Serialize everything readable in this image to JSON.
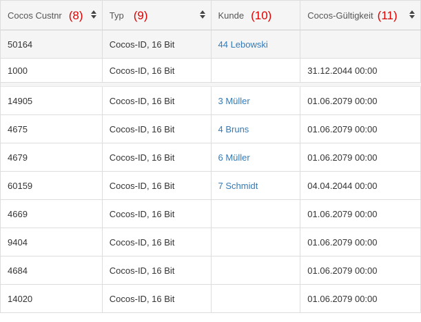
{
  "table": {
    "headers": [
      {
        "label": "Cocos Custnr",
        "annotation": "(8)"
      },
      {
        "label": "Typ",
        "annotation": "(9)"
      },
      {
        "label": "Kunde",
        "annotation": "(10)"
      },
      {
        "label": "Cocos-Gültigkeit",
        "annotation": "(11)"
      }
    ],
    "rows": [
      {
        "custnr": "50164",
        "typ": "Cocos-ID, 16 Bit",
        "kunde": "44 Lebowski",
        "gueltigkeit": ""
      },
      {
        "custnr": "1000",
        "typ": "Cocos-ID, 16 Bit",
        "kunde": "",
        "gueltigkeit": "31.12.2044 00:00"
      },
      {
        "custnr": "14905",
        "typ": "Cocos-ID, 16 Bit",
        "kunde": "3 Müller",
        "gueltigkeit": "01.06.2079 00:00"
      },
      {
        "custnr": "4675",
        "typ": "Cocos-ID, 16 Bit",
        "kunde": "4 Bruns",
        "gueltigkeit": "01.06.2079 00:00"
      },
      {
        "custnr": "4679",
        "typ": "Cocos-ID, 16 Bit",
        "kunde": "6 Müller",
        "gueltigkeit": "01.06.2079 00:00"
      },
      {
        "custnr": "60159",
        "typ": "Cocos-ID, 16 Bit",
        "kunde": "7 Schmidt",
        "gueltigkeit": "04.04.2044 00:00"
      },
      {
        "custnr": "4669",
        "typ": "Cocos-ID, 16 Bit",
        "kunde": "",
        "gueltigkeit": "01.06.2079 00:00"
      },
      {
        "custnr": "9404",
        "typ": "Cocos-ID, 16 Bit",
        "kunde": "",
        "gueltigkeit": "01.06.2079 00:00"
      },
      {
        "custnr": "4684",
        "typ": "Cocos-ID, 16 Bit",
        "kunde": "",
        "gueltigkeit": "01.06.2079 00:00"
      },
      {
        "custnr": "14020",
        "typ": "Cocos-ID, 16 Bit",
        "kunde": "",
        "gueltigkeit": "01.06.2079 00:00"
      }
    ]
  },
  "colors": {
    "link": "#337ab7",
    "annotation": "#e00000",
    "header_bg": "#f5f5f5",
    "border": "#dddddd"
  },
  "icons": {
    "sort": "sort-icon"
  }
}
